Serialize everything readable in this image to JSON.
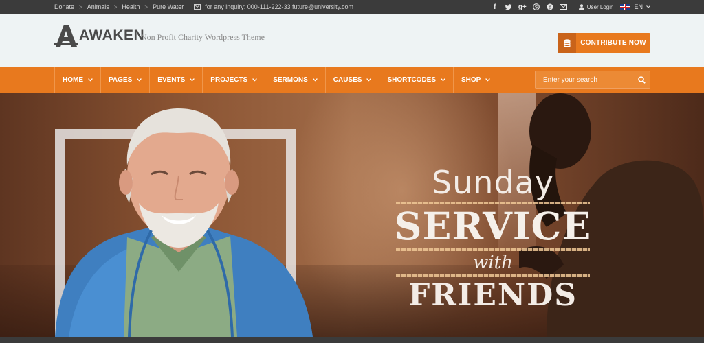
{
  "topbar": {
    "breadcrumbs": [
      "Donate",
      "Animals",
      "Health",
      "Pure Water"
    ],
    "separator": ">",
    "inquiry": "for any inquiry: 000-111-222-33 future@university.com",
    "user_login": "User Login",
    "language": "EN",
    "social_icons": [
      "facebook-icon",
      "twitter-icon",
      "google-plus-icon",
      "skype-icon",
      "pinterest-icon",
      "email-icon"
    ]
  },
  "header": {
    "logo_text": "AWAKEN",
    "tagline": "Non Profit Charity Wordpress Theme",
    "contribute_label": "CONTRIBUTE NOW"
  },
  "nav": {
    "items": [
      {
        "label": "HOME"
      },
      {
        "label": "PAGES"
      },
      {
        "label": "EVENTS"
      },
      {
        "label": "PROJECTS"
      },
      {
        "label": "SERMONS"
      },
      {
        "label": "CAUSES"
      },
      {
        "label": "SHORTCODES"
      },
      {
        "label": "SHOP"
      }
    ],
    "search_placeholder": "Enter your search"
  },
  "hero": {
    "line1": "Sunday",
    "line2": "SERVICE",
    "line3": "with",
    "line4": "FRIENDS"
  },
  "colors": {
    "accent": "#e8791e",
    "topbar": "#3b3b3b",
    "header_bg": "#eef3f4"
  }
}
